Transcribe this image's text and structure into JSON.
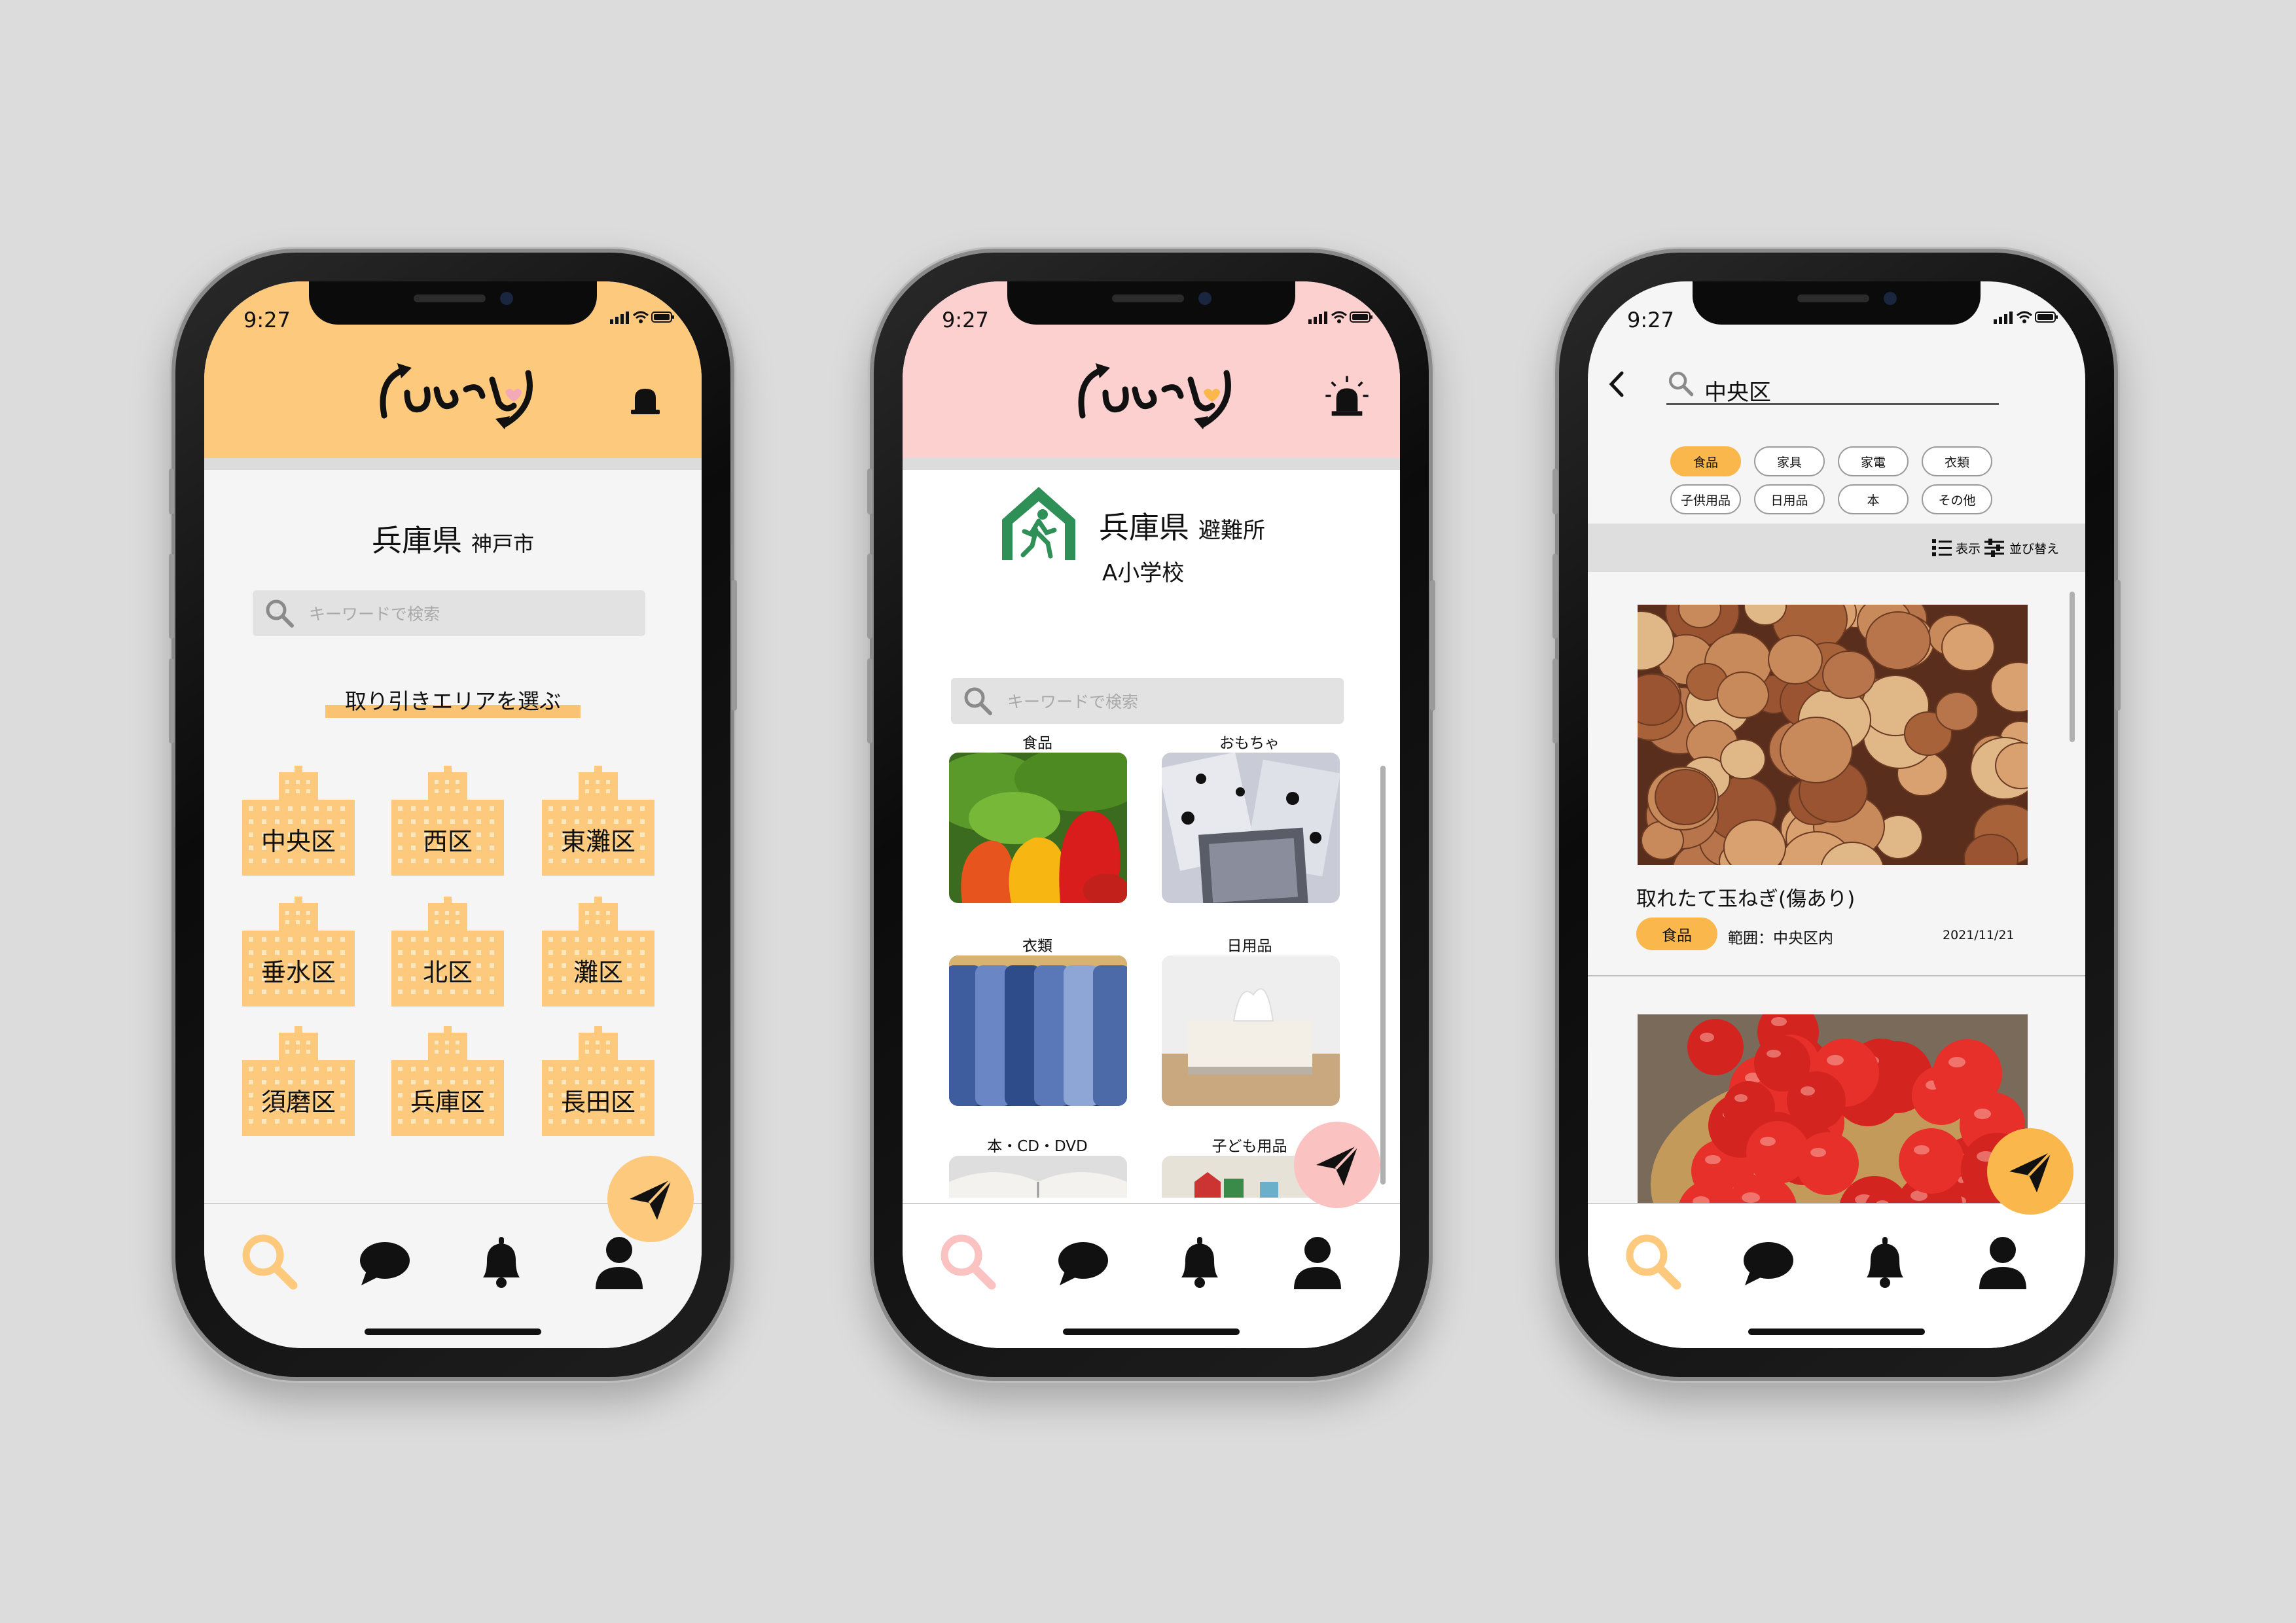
{
  "status": {
    "time": "9:27"
  },
  "colors": {
    "orange_header": "#fcc97d",
    "pink_header": "#fdd0d0",
    "orange_accent": "#f9b74c",
    "pink_accent": "#fbc2c2",
    "shelter_green": "#2e8f57"
  },
  "screen1": {
    "prefecture": "兵庫県",
    "city": "神戸市",
    "search_placeholder": "キーワードで検索",
    "area_title": "取り引きエリアを選ぶ",
    "districts": [
      "中央区",
      "西区",
      "東灘区",
      "垂水区",
      "北区",
      "灘区",
      "須磨区",
      "兵庫区",
      "長田区"
    ]
  },
  "screen2": {
    "prefecture": "兵庫県",
    "shelter_label": "避難所",
    "shelter_name": "A小学校",
    "search_placeholder": "キーワードで検索",
    "categories": [
      {
        "label": "食品",
        "image": "vegetables-photo"
      },
      {
        "label": "おもちゃ",
        "image": "playing-cards-photo"
      },
      {
        "label": "衣類",
        "image": "sweaters-photo"
      },
      {
        "label": "日用品",
        "image": "tissue-box-photo"
      },
      {
        "label": "本・CD・DVD",
        "image": "book-photo"
      },
      {
        "label": "子ども用品",
        "image": "toy-blocks-photo"
      }
    ]
  },
  "screen3": {
    "search_value": "中央区",
    "chips": [
      {
        "label": "食品",
        "active": true
      },
      {
        "label": "家具",
        "active": false
      },
      {
        "label": "家電",
        "active": false
      },
      {
        "label": "衣類",
        "active": false
      },
      {
        "label": "子供用品",
        "active": false
      },
      {
        "label": "日用品",
        "active": false
      },
      {
        "label": "本",
        "active": false
      },
      {
        "label": "その他",
        "active": false
      }
    ],
    "view_label": "表示",
    "sort_label": "並び替え",
    "items": [
      {
        "title": "取れたて玉ねぎ(傷あり)",
        "tag": "食品",
        "range": "範囲：中央区内",
        "date": "2021/11/21",
        "image": "onions-photo"
      },
      {
        "image": "tomatoes-photo"
      }
    ]
  },
  "nav": [
    "search-tab",
    "chat-tab",
    "notifications-tab",
    "profile-tab"
  ]
}
